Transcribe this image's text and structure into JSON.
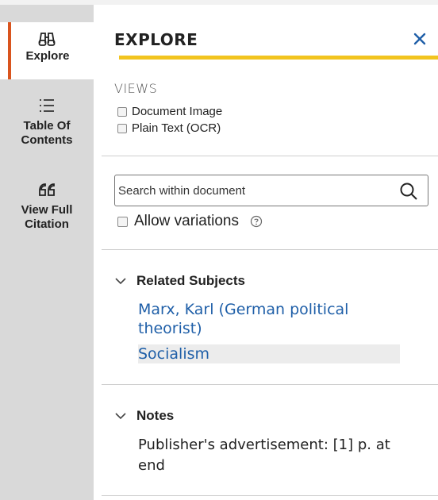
{
  "sidebar": {
    "items": [
      {
        "label": "Explore",
        "icon": "binoculars-icon",
        "active": true
      },
      {
        "label": "Table Of Contents",
        "icon": "list-icon",
        "active": false
      },
      {
        "label": "View Full Citation",
        "icon": "quote-icon",
        "active": false
      }
    ]
  },
  "panel": {
    "title": "EXPLORE",
    "close_icon": "close-icon"
  },
  "views": {
    "heading": "VIEWS",
    "options": [
      "Document Image",
      "Plain Text (OCR)"
    ]
  },
  "search": {
    "placeholder": "Search within document",
    "value": "",
    "allow_variations_label": "Allow variations"
  },
  "related_subjects": {
    "heading": "Related Subjects",
    "items": [
      "Marx, Karl (German political theorist)",
      "Socialism"
    ]
  },
  "notes": {
    "heading": "Notes",
    "text": "Publisher's advertisement: [1] p. at end"
  },
  "colors": {
    "accent_orange": "#d9541e",
    "title_bar_yellow": "#f2c41f",
    "link_blue": "#1f5fa8",
    "rail_gray": "#d9d9d9"
  }
}
